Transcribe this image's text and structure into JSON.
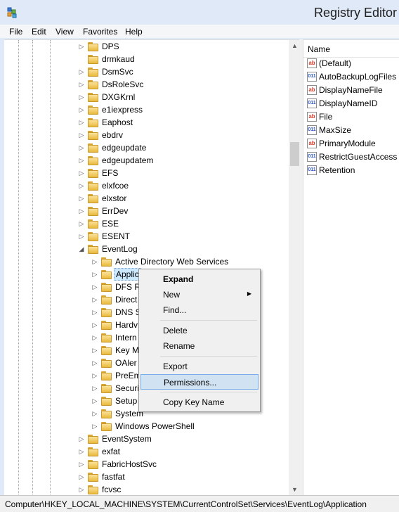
{
  "window": {
    "title": "Registry Editor",
    "app_icon": "registry-icon"
  },
  "menu": [
    "File",
    "Edit",
    "View",
    "Favorites",
    "Help"
  ],
  "tree": {
    "rows": [
      {
        "label": "DPS",
        "level": 1,
        "expander": "collapsed"
      },
      {
        "label": "drmkaud",
        "level": 1,
        "expander": "none"
      },
      {
        "label": "DsmSvc",
        "level": 1,
        "expander": "collapsed"
      },
      {
        "label": "DsRoleSvc",
        "level": 1,
        "expander": "collapsed"
      },
      {
        "label": "DXGKrnl",
        "level": 1,
        "expander": "collapsed"
      },
      {
        "label": "e1iexpress",
        "level": 1,
        "expander": "collapsed"
      },
      {
        "label": "Eaphost",
        "level": 1,
        "expander": "collapsed"
      },
      {
        "label": "ebdrv",
        "level": 1,
        "expander": "collapsed"
      },
      {
        "label": "edgeupdate",
        "level": 1,
        "expander": "collapsed"
      },
      {
        "label": "edgeupdatem",
        "level": 1,
        "expander": "collapsed"
      },
      {
        "label": "EFS",
        "level": 1,
        "expander": "collapsed"
      },
      {
        "label": "elxfcoe",
        "level": 1,
        "expander": "collapsed"
      },
      {
        "label": "elxstor",
        "level": 1,
        "expander": "collapsed"
      },
      {
        "label": "ErrDev",
        "level": 1,
        "expander": "collapsed"
      },
      {
        "label": "ESE",
        "level": 1,
        "expander": "collapsed"
      },
      {
        "label": "ESENT",
        "level": 1,
        "expander": "collapsed"
      },
      {
        "label": "EventLog",
        "level": 1,
        "expander": "expanded"
      },
      {
        "label": "Active Directory Web Services",
        "level": 2,
        "expander": "collapsed"
      },
      {
        "label": "Applic",
        "level": 2,
        "expander": "collapsed",
        "selected": true
      },
      {
        "label": "DFS R",
        "level": 2,
        "expander": "collapsed"
      },
      {
        "label": "Direct",
        "level": 2,
        "expander": "collapsed"
      },
      {
        "label": "DNS S",
        "level": 2,
        "expander": "collapsed"
      },
      {
        "label": "Hardv",
        "level": 2,
        "expander": "collapsed"
      },
      {
        "label": "Intern",
        "level": 2,
        "expander": "collapsed"
      },
      {
        "label": "Key M",
        "level": 2,
        "expander": "collapsed"
      },
      {
        "label": "OAler",
        "level": 2,
        "expander": "collapsed"
      },
      {
        "label": "PreEm",
        "level": 2,
        "expander": "collapsed"
      },
      {
        "label": "Securi",
        "level": 2,
        "expander": "collapsed"
      },
      {
        "label": "Setup",
        "level": 2,
        "expander": "collapsed"
      },
      {
        "label": "System",
        "level": 2,
        "expander": "collapsed"
      },
      {
        "label": "Windows PowerShell",
        "level": 2,
        "expander": "collapsed"
      },
      {
        "label": "EventSystem",
        "level": 1,
        "expander": "collapsed"
      },
      {
        "label": "exfat",
        "level": 1,
        "expander": "collapsed"
      },
      {
        "label": "FabricHostSvc",
        "level": 1,
        "expander": "collapsed"
      },
      {
        "label": "fastfat",
        "level": 1,
        "expander": "collapsed"
      },
      {
        "label": "fcvsc",
        "level": 1,
        "expander": "collapsed"
      }
    ]
  },
  "values": {
    "column_name": "Name",
    "rows": [
      {
        "name": "(Default)",
        "type": "sz"
      },
      {
        "name": "AutoBackupLogFiles",
        "type": "dword"
      },
      {
        "name": "DisplayNameFile",
        "type": "sz"
      },
      {
        "name": "DisplayNameID",
        "type": "dword"
      },
      {
        "name": "File",
        "type": "sz"
      },
      {
        "name": "MaxSize",
        "type": "dword"
      },
      {
        "name": "PrimaryModule",
        "type": "sz"
      },
      {
        "name": "RestrictGuestAccess",
        "type": "dword"
      },
      {
        "name": "Retention",
        "type": "dword"
      }
    ]
  },
  "context_menu": {
    "items": [
      {
        "label": "Expand",
        "bold": true
      },
      {
        "label": "New",
        "submenu": true
      },
      {
        "label": "Find..."
      },
      {
        "separator": true
      },
      {
        "label": "Delete"
      },
      {
        "label": "Rename"
      },
      {
        "separator": true
      },
      {
        "label": "Export"
      },
      {
        "label": "Permissions...",
        "selected": true
      },
      {
        "separator": true
      },
      {
        "label": "Copy Key Name"
      }
    ]
  },
  "status_bar": {
    "path": "Computer\\HKEY_LOCAL_MACHINE\\SYSTEM\\CurrentControlSet\\Services\\EventLog\\Application"
  }
}
